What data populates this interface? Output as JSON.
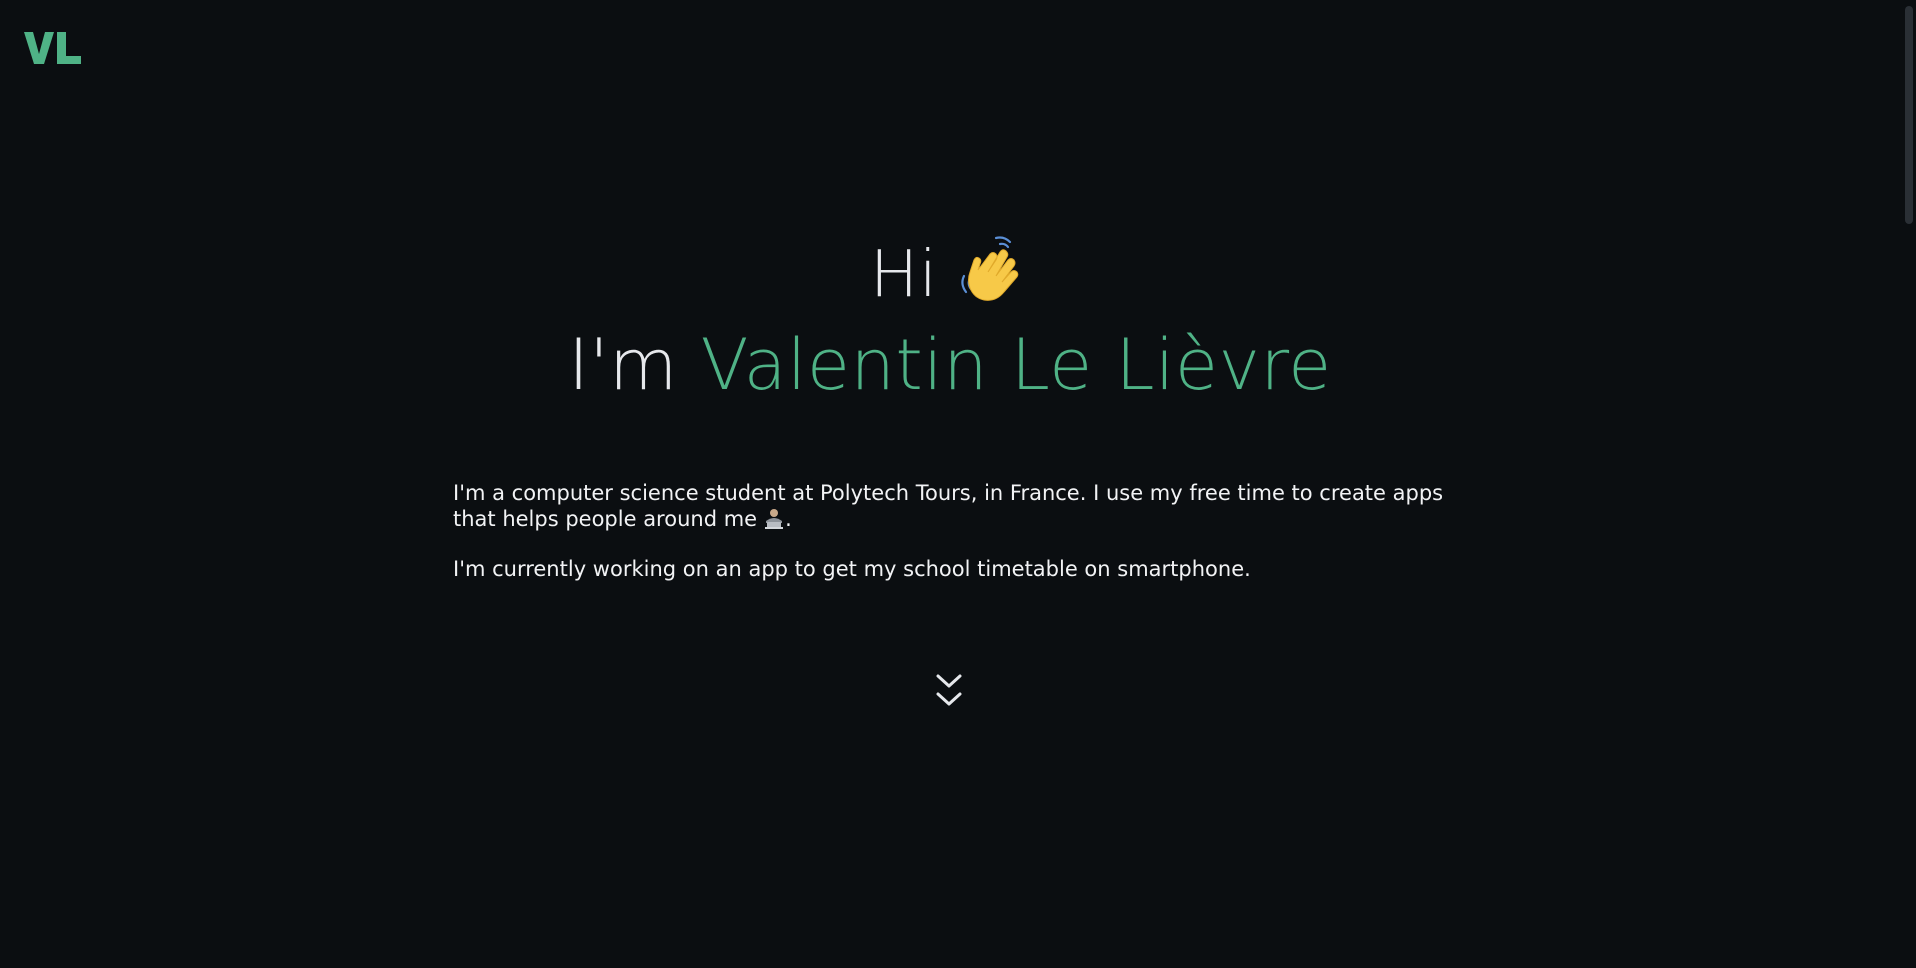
{
  "header": {
    "logo_text": "VL",
    "logo_color": "#4fb286"
  },
  "hero": {
    "greeting": "Hi",
    "greeting_icon": "waving-hand-icon",
    "name_prefix": "I'm",
    "name": "Valentin Le Lièvre",
    "accent_color": "#4fb286"
  },
  "intro": {
    "paragraph1": "I'm a computer science student at Polytech Tours, in France. I use my free time to create apps that helps people around me",
    "paragraph1_icon": "technologist-icon",
    "paragraph1_end": ".",
    "paragraph2": "I'm currently working on an app to get my school timetable on smartphone."
  },
  "scroll_hint": {
    "icon": "double-chevron-down-icon"
  },
  "colors": {
    "background": "#0b0e11",
    "text": "#e6e8ec"
  }
}
